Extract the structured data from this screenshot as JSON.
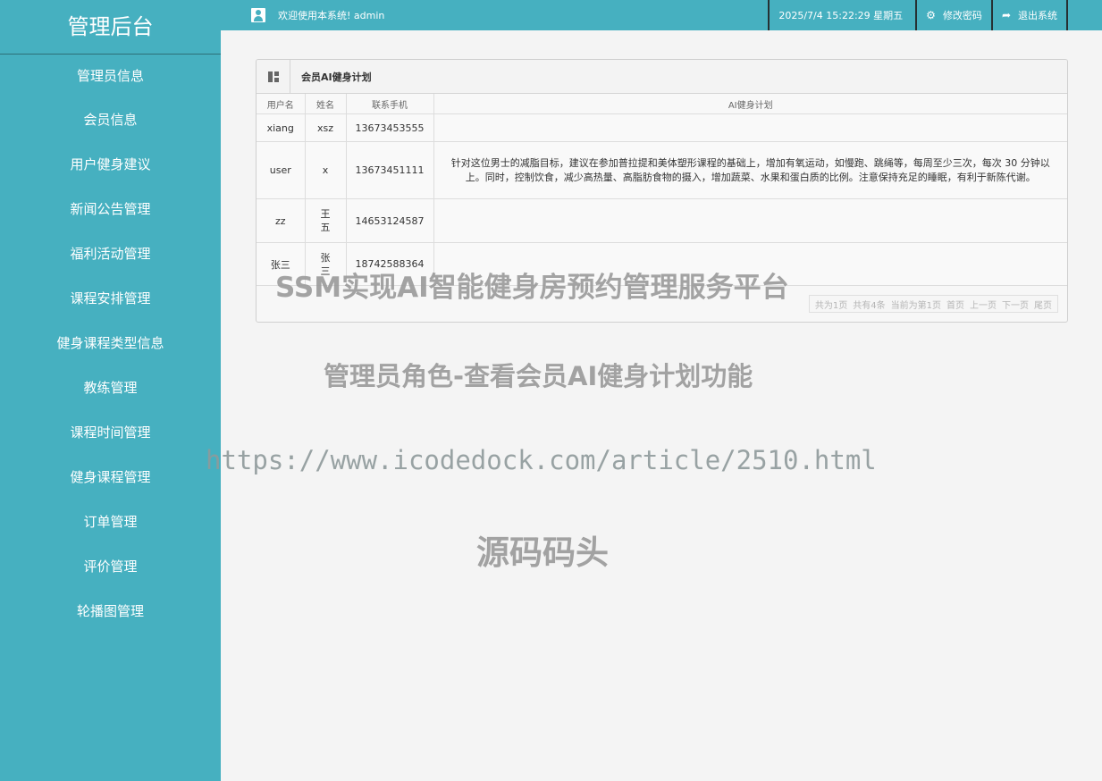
{
  "sidebar": {
    "title": "管理后台",
    "items": [
      {
        "label": "管理员信息"
      },
      {
        "label": "会员信息"
      },
      {
        "label": "用户健身建议"
      },
      {
        "label": "新闻公告管理"
      },
      {
        "label": "福利活动管理"
      },
      {
        "label": "课程安排管理"
      },
      {
        "label": "健身课程类型信息"
      },
      {
        "label": "教练管理"
      },
      {
        "label": "课程时间管理"
      },
      {
        "label": "健身课程管理"
      },
      {
        "label": "订单管理"
      },
      {
        "label": "评价管理"
      },
      {
        "label": "轮播图管理"
      }
    ]
  },
  "topbar": {
    "welcome": "欢迎使用本系统! admin",
    "datetime": "2025/7/4 15:22:29 星期五",
    "change_password": "修改密码",
    "logout": "退出系统"
  },
  "panel": {
    "title": "会员AI健身计划",
    "columns": [
      "用户名",
      "姓名",
      "联系手机",
      "AI健身计划"
    ],
    "rows": [
      {
        "username": "xiang",
        "name": "xsz",
        "phone": "13673453555",
        "plan": ""
      },
      {
        "username": "user",
        "name": "x",
        "phone": "13673451111",
        "plan": "针对这位男士的减脂目标，建议在参加普拉提和美体塑形课程的基础上，增加有氧运动，如慢跑、跳绳等，每周至少三次，每次 30 分钟以上。同时，控制饮食，减少高热量、高脂肪食物的摄入，增加蔬菜、水果和蛋白质的比例。注意保持充足的睡眠，有利于新陈代谢。"
      },
      {
        "username": "zz",
        "name": "王五",
        "phone": "14653124587",
        "plan": ""
      },
      {
        "username": "张三",
        "name": "张三",
        "phone": "18742588364",
        "plan": ""
      }
    ],
    "pager": [
      "共为1页",
      "共有4条",
      "当前为第1页",
      "首页",
      "上一页",
      "下一页",
      "尾页"
    ]
  },
  "watermarks": [
    "SSM实现AI智能健身房预约管理服务平台",
    "管理员角色-查看会员AI健身计划功能",
    "https://www.icodedock.com/article/2510.html",
    "源码码头"
  ],
  "colors": {
    "sidebar_bg": "#46b0c0",
    "topbar_bg": "#46b0c0"
  },
  "icons": {
    "user": "user-icon",
    "settings": "gear-icon",
    "logout": "share-arrow-icon",
    "panel": "grid-icon"
  }
}
